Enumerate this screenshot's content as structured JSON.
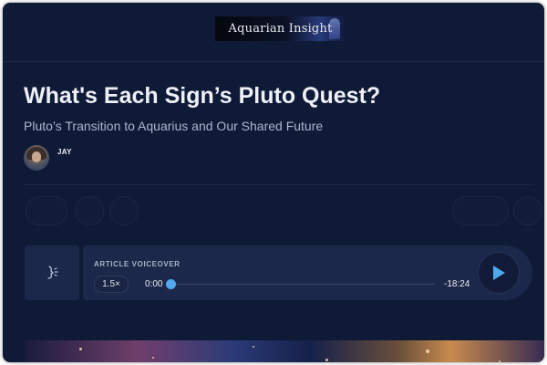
{
  "header": {
    "logo_text": "Aquarian Insight"
  },
  "article": {
    "title": "What's Each Sign’s Pluto Quest?",
    "subtitle": "Pluto’s Transition to Aquarius and Our Shared Future",
    "author": "JAY"
  },
  "voiceover": {
    "label": "ARTICLE VOICEOVER",
    "speed": "1.5×",
    "current_time": "0:00",
    "remaining_time": "-18:24",
    "progress": 0
  },
  "colors": {
    "background": "#0f1a37",
    "player_bg": "#1c2849",
    "accent": "#4fa9ec"
  },
  "icons": {
    "voiceover": "voiceover-icon",
    "play": "play-icon"
  }
}
